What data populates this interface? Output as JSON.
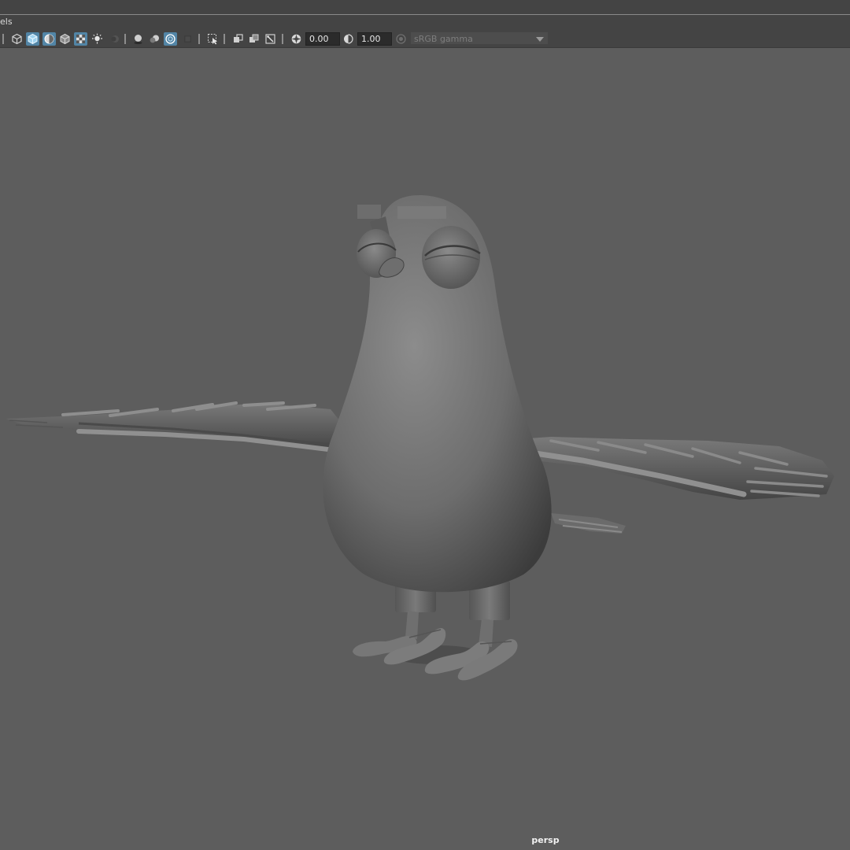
{
  "panel_menu": {
    "label": "els"
  },
  "toolbar": {
    "exposure_value": "0.00",
    "gamma_value": "1.00",
    "color_space": "sRGB gamma"
  },
  "viewport": {
    "camera_label": "persp"
  }
}
